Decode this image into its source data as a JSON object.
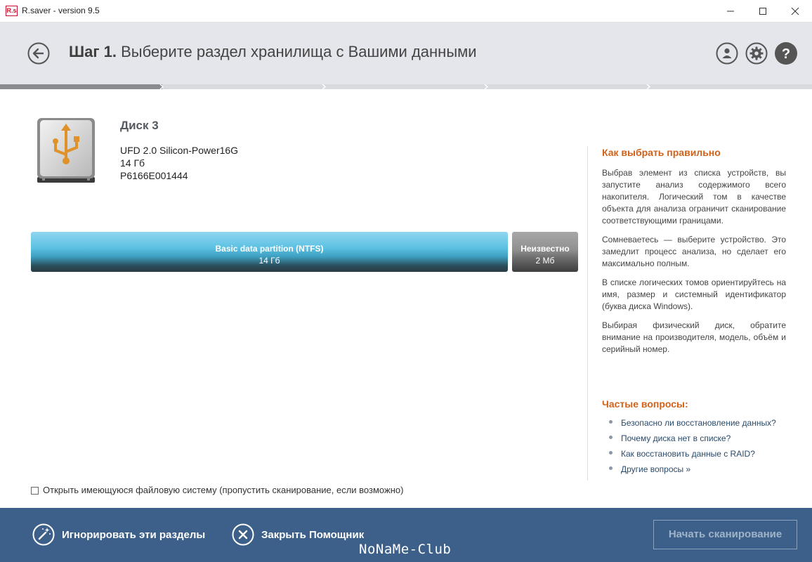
{
  "window": {
    "logo_text": "R.s",
    "title": "R.saver - version 9.5"
  },
  "header": {
    "step_label": "Шаг 1.",
    "step_title": "Выберите раздел хранилища с Вашими данными"
  },
  "progress": {
    "steps": 5,
    "current_step": 1
  },
  "disk": {
    "name": "Диск 3",
    "model": "UFD 2.0 Silicon-Power16G",
    "size": "14 Гб",
    "serial": "P6166E001444"
  },
  "partitions": [
    {
      "name": "Basic data partition (NTFS)",
      "size": "14 Гб",
      "color": "#5cc1e2"
    },
    {
      "name": "Неизвестно",
      "size": "2 Мб",
      "color": "#8f8f8f"
    }
  ],
  "options": {
    "open_fs_label": "Открыть имеющуюся файловую систему (пропустить сканирование, если возможно)",
    "open_fs_checked": false
  },
  "help": {
    "title": "Как выбрать правильно",
    "paragraphs": [
      "Выбрав элемент из списка устройств, вы запустите анализ содержимого всего накопителя. Логический том в качестве объекта для анализа ограничит сканирование соответствующими границами.",
      "Сомневаетесь — выберите устройство. Это замедлит процесс анализа, но сделает его максимально полным.",
      "В списке логических томов ориентируйтесь на имя, размер и системный идентификатор (буква диска Windows).",
      "Выбирая физический диск, обратите внимание на производителя, модель, объём и серийный номер."
    ]
  },
  "faq": {
    "title": "Частые вопросы:",
    "items": [
      "Безопасно ли восстановление данных?",
      "Почему диска нет в списке?",
      "Как восстановить данные с RAID?",
      "Другие вопросы »"
    ]
  },
  "footer": {
    "ignore_label": "Игнорировать эти разделы",
    "close_label": "Закрыть Помощник",
    "scan_label": "Начать сканирование",
    "watermark": "NoNaMe-Club"
  },
  "colors": {
    "accent_orange": "#d0621a",
    "footer_bg": "#3c6089",
    "header_bg": "#e5e6ec",
    "partition_blue": "#5cc1e2"
  },
  "icons": {
    "back": "arrow-left-icon",
    "user": "user-icon",
    "settings": "gear-icon",
    "help": "question-icon",
    "disk": "usb-drive-icon",
    "ignore": "magic-wand-icon",
    "close": "close-icon"
  }
}
